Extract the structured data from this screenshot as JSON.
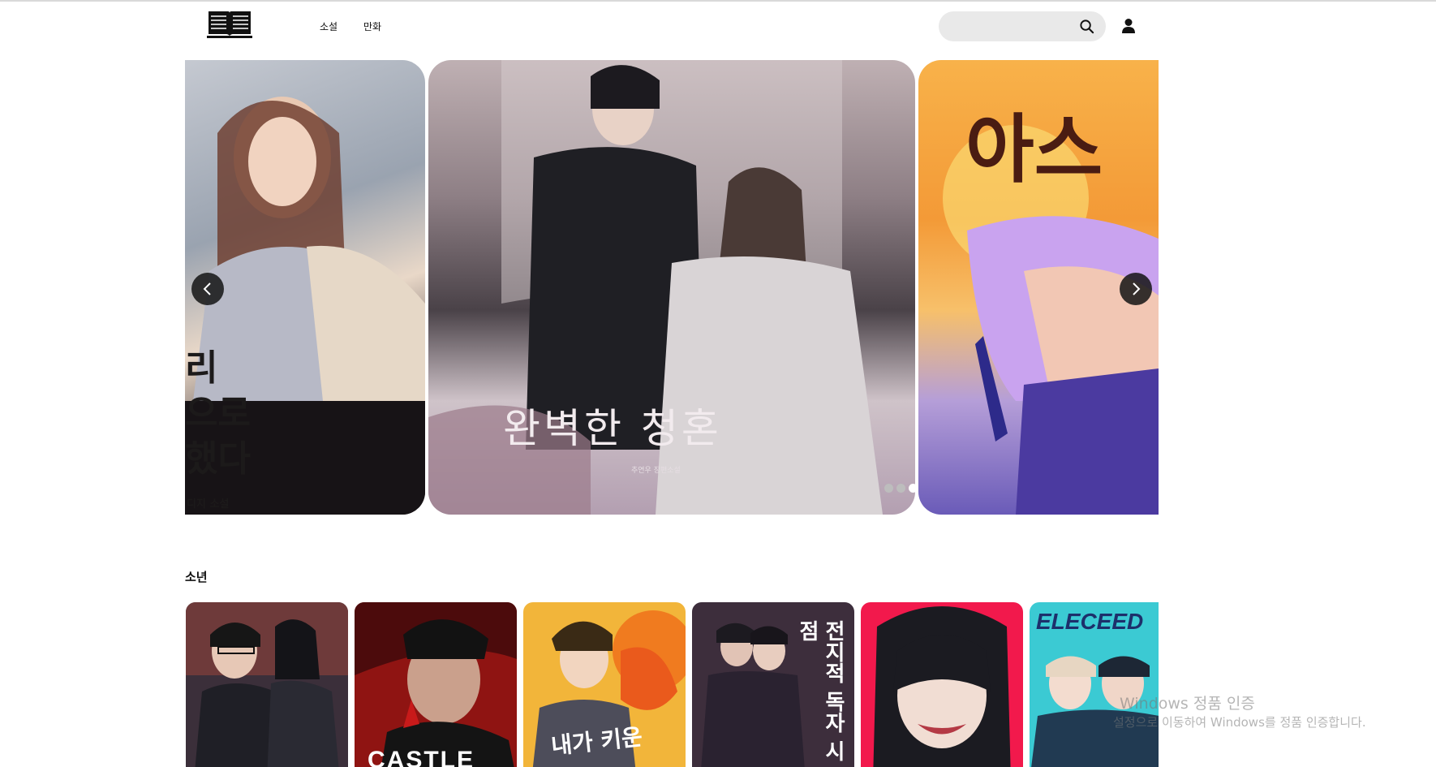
{
  "header": {
    "logo": "book-logo",
    "nav": [
      "소설",
      "만화"
    ],
    "search_placeholder": ""
  },
  "carousel": {
    "slides": [
      {
        "title_lines": [
          "리",
          "으로",
          "했다"
        ],
        "author": "디지 소설"
      },
      {
        "title": "완벽한 청혼",
        "subtitle": "추연우 장편소설"
      },
      {
        "title": "아스"
      }
    ],
    "dots": 5,
    "active_dot": 2
  },
  "section": {
    "title": "소년",
    "cards": [
      {
        "title": "",
        "colors": [
          "#3b2f3a",
          "#9b4a3a",
          "#1a1a1f"
        ]
      },
      {
        "title": "CASTLE",
        "colors": [
          "#a01816",
          "#5b0f10",
          "#161616"
        ]
      },
      {
        "title": "내가 키운",
        "colors": [
          "#f3c23a",
          "#e67a1e",
          "#7a3b12"
        ]
      },
      {
        "title": "전지적 독자 시점",
        "colors": [
          "#3b2a40",
          "#6a4a5a",
          "#2a1e28"
        ]
      },
      {
        "title": "",
        "colors": [
          "#ff2e5c",
          "#f21a4d",
          "#1b1b22"
        ]
      },
      {
        "title": "ELECEED",
        "colors": [
          "#39c6cf",
          "#1e8f9b",
          "#213a52"
        ]
      }
    ]
  },
  "watermark": {
    "title": "Windows 정품 인증",
    "subtitle": "설정으로 이동하여 Windows를 정품 인증합니다."
  }
}
